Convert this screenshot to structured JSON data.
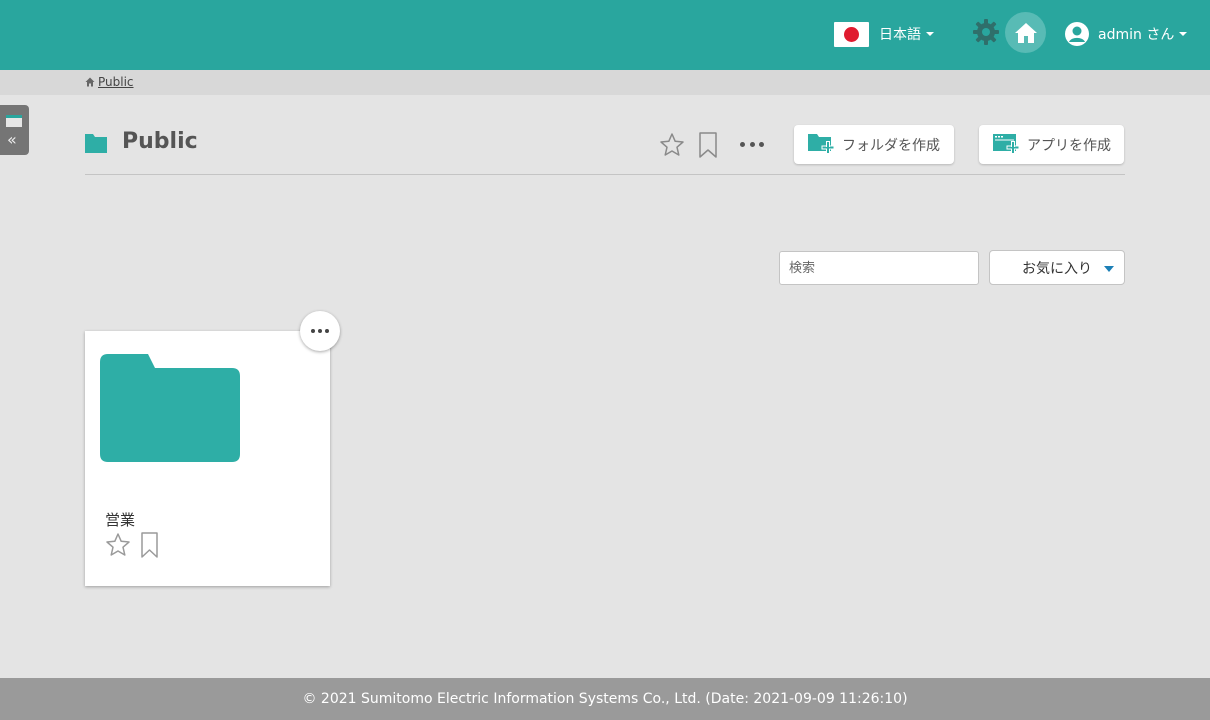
{
  "colors": {
    "header_bg": "#29a69e",
    "accent": "#2eaea6",
    "footer_bg": "#9a9a9a",
    "flag_red": "#e01b2f"
  },
  "header": {
    "language": {
      "label": "日本語",
      "icon": "japan-flag-icon"
    },
    "settings_icon": "gear-icon",
    "home_icon": "home-icon",
    "user": {
      "label": "admin さん",
      "icon": "user-avatar-icon"
    }
  },
  "breadcrumb": {
    "icon": "home-icon",
    "items": [
      "Public"
    ]
  },
  "sidebar_toggle": {
    "icon": "double-chevron-left-icon"
  },
  "page": {
    "title": "Public",
    "title_icon": "folder-icon",
    "actions": {
      "create_folder_label": "フォルダを作成",
      "create_app_label": "アプリを作成"
    }
  },
  "filters": {
    "search_placeholder": "検索",
    "search_value": "",
    "sort_selected": "お気に入り"
  },
  "items": [
    {
      "name": "営業",
      "type": "folder",
      "favorite": false,
      "bookmarked": false
    }
  ],
  "footer": {
    "text": "© 2021 Sumitomo Electric Information Systems Co., Ltd. (Date: 2021-09-09 11:26:10)"
  }
}
